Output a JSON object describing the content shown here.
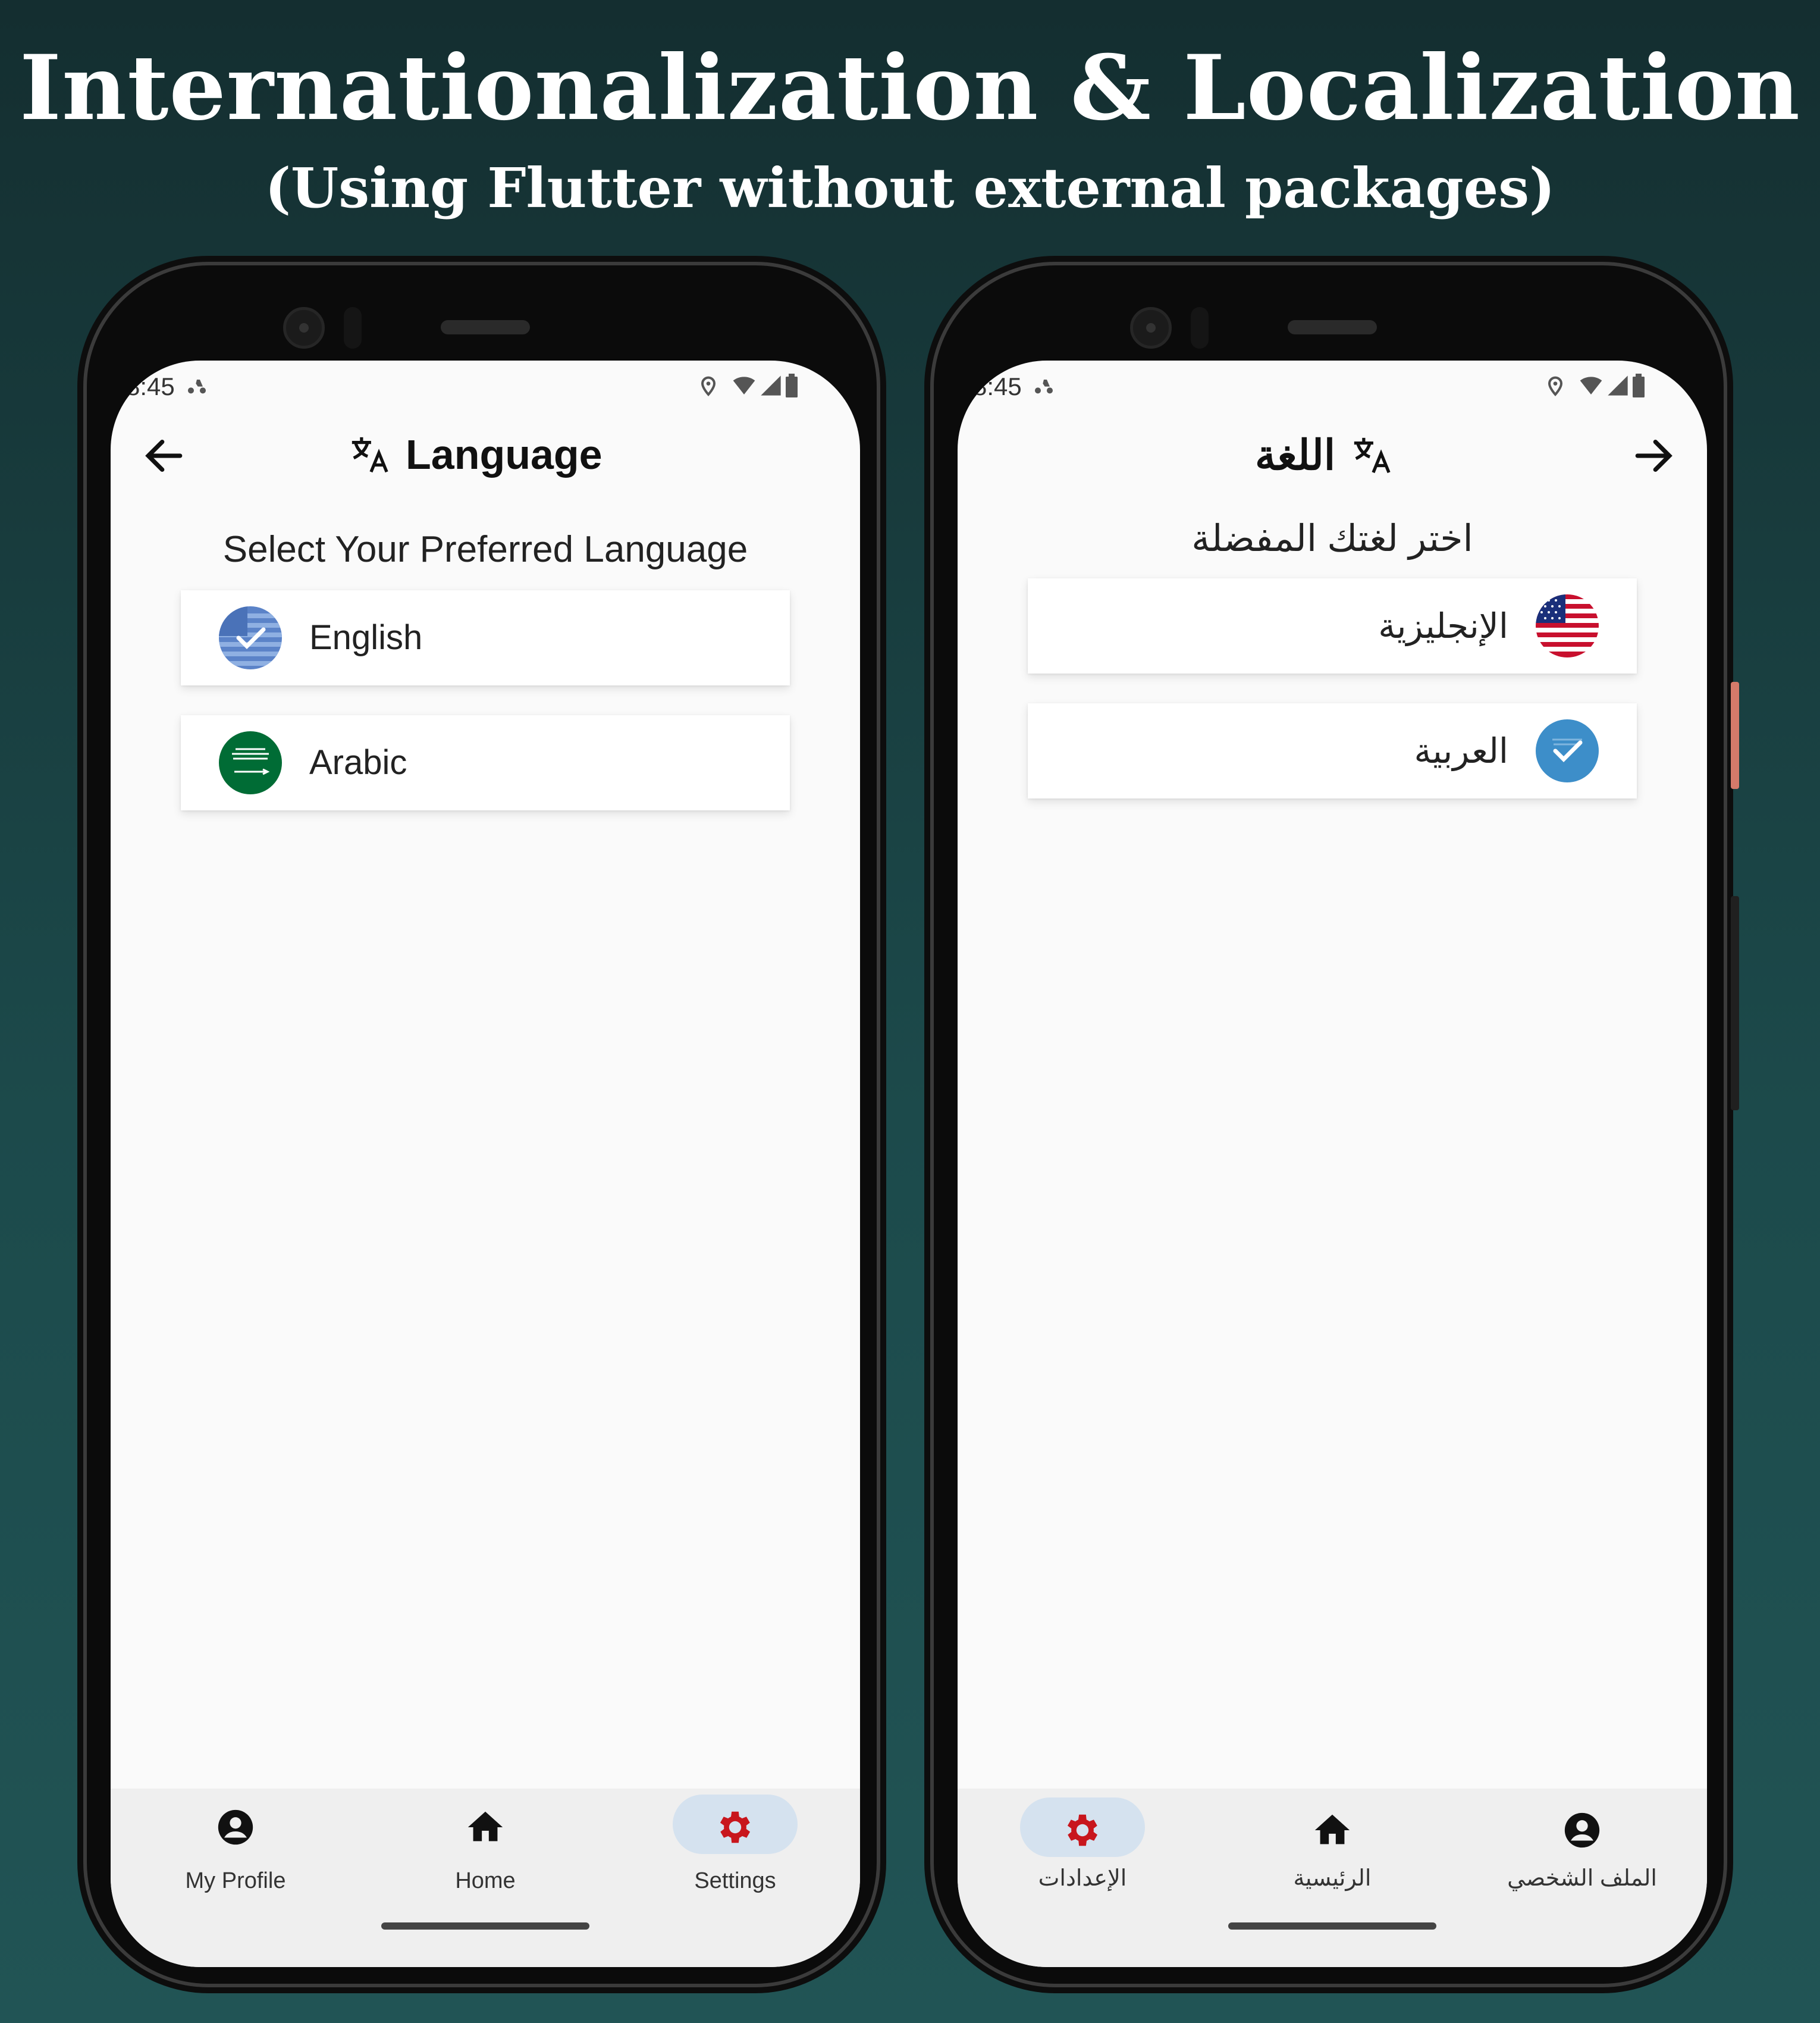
{
  "header": {
    "title": "Internationalization & Localization",
    "subtitle": "(Using Flutter without external packages)"
  },
  "colors": {
    "background": "#142e30",
    "accent_active_pill": "#d5e2ef",
    "settings_icon": "#c8161d",
    "selected_check": "#3d8ec9",
    "saudi_green": "#006c35"
  },
  "left_phone": {
    "status_time": "8:45",
    "appbar": {
      "title": "Language",
      "back_icon": "arrow-left-icon",
      "title_icon": "translate-icon"
    },
    "prompt": "Select Your Preferred Language",
    "languages": [
      {
        "label": "English",
        "icon": "us-flag-icon",
        "selected": true
      },
      {
        "label": "Arabic",
        "icon": "saudi-flag-icon",
        "selected": false
      }
    ],
    "nav": [
      {
        "label": "My Profile",
        "icon": "account-icon",
        "active": false
      },
      {
        "label": "Home",
        "icon": "home-icon",
        "active": false
      },
      {
        "label": "Settings",
        "icon": "gear-icon",
        "active": true
      }
    ]
  },
  "right_phone": {
    "status_time": "8:45",
    "appbar": {
      "title": "اللغة",
      "back_icon": "arrow-right-icon",
      "title_icon": "translate-icon"
    },
    "prompt": "اختر لغتك المفضلة",
    "languages": [
      {
        "label": "الإنجليزية",
        "icon": "us-flag-icon",
        "selected": false
      },
      {
        "label": "العربية",
        "icon": "saudi-flag-icon",
        "selected": true
      }
    ],
    "nav": [
      {
        "label": "الإعدادات",
        "icon": "gear-icon",
        "active": true
      },
      {
        "label": "الرئيسية",
        "icon": "home-icon",
        "active": false
      },
      {
        "label": "الملف الشخصي",
        "icon": "account-icon",
        "active": false
      }
    ]
  }
}
